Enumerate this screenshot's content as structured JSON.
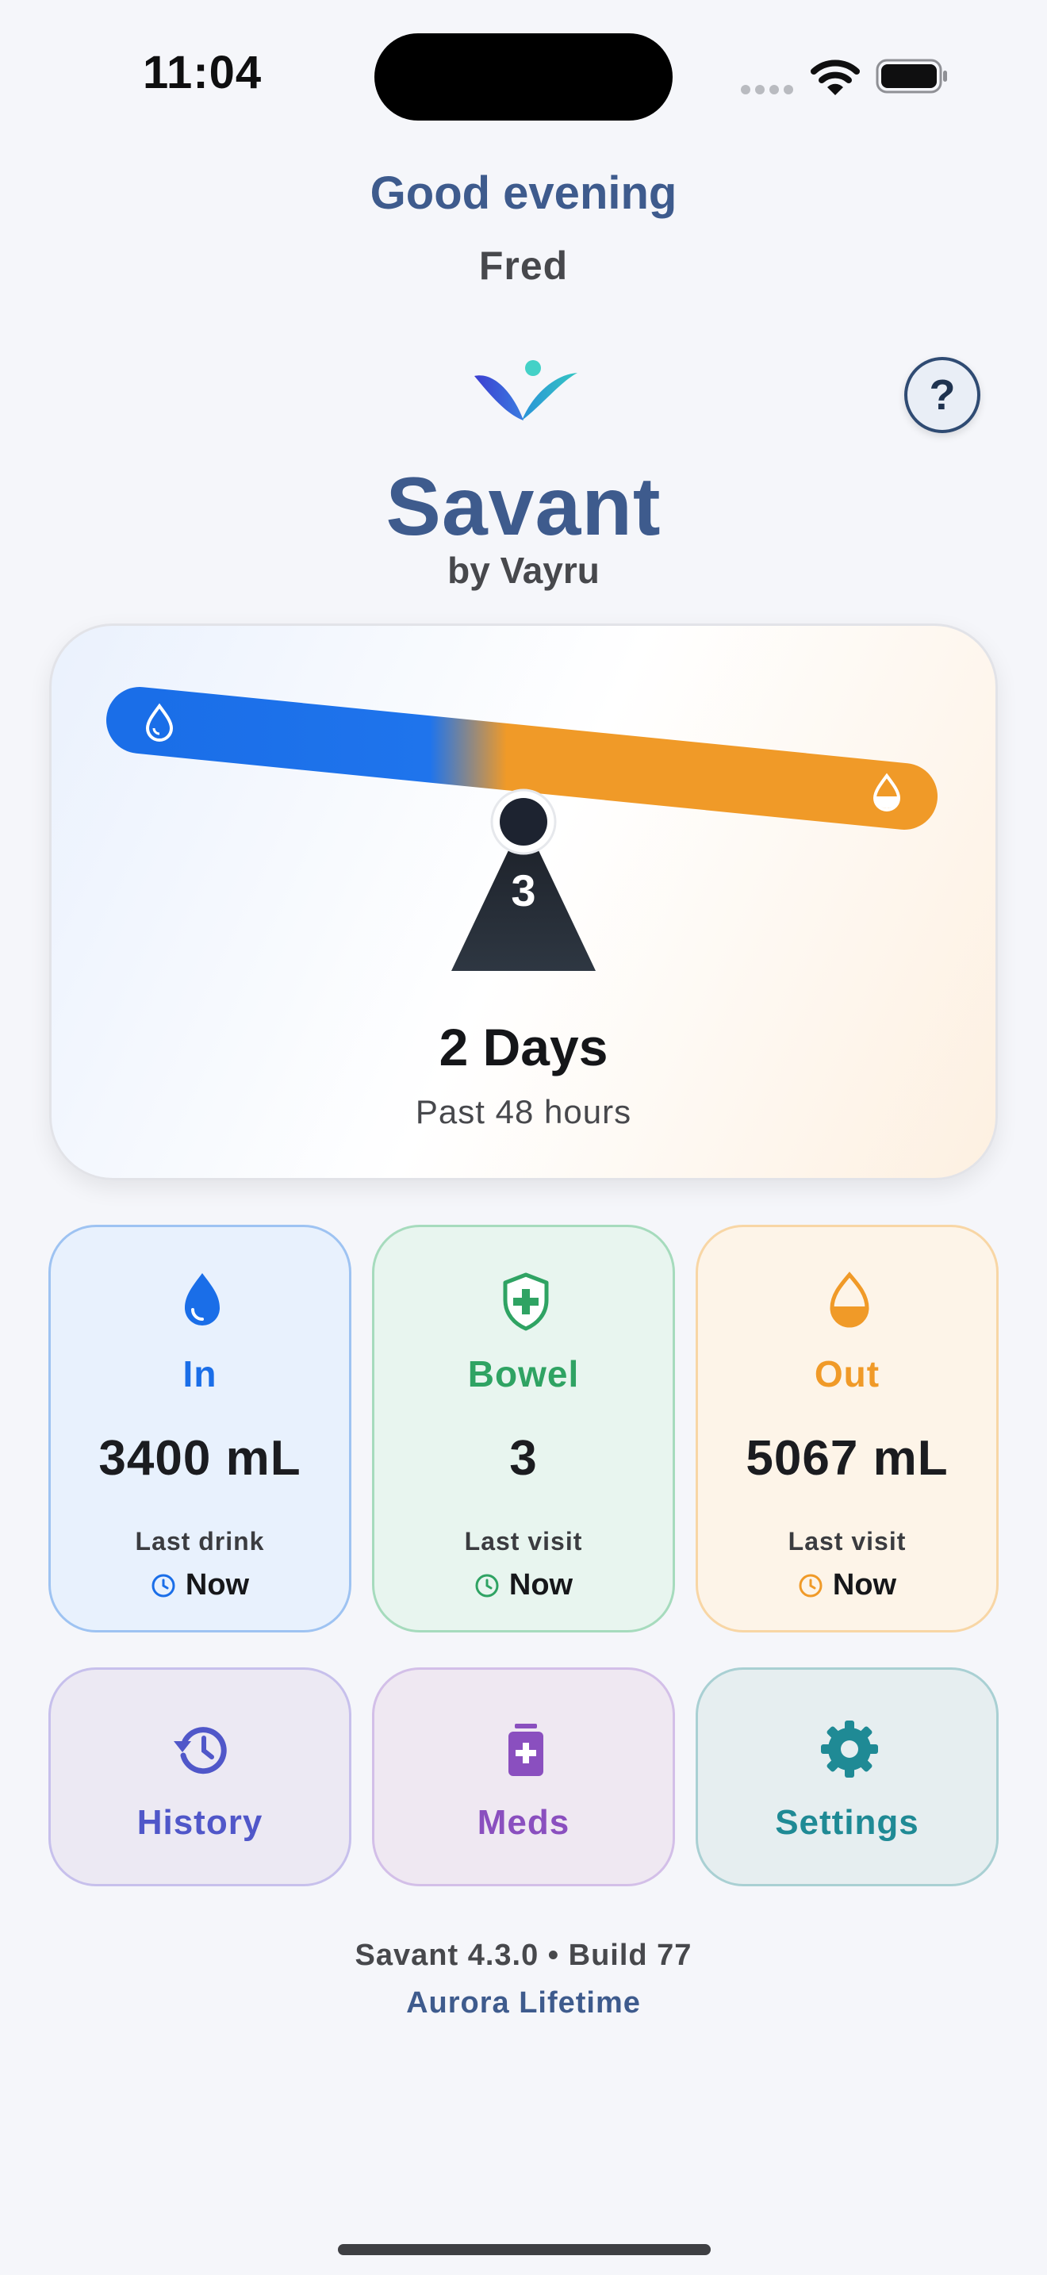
{
  "status_bar": {
    "time": "11:04"
  },
  "header": {
    "greeting": "Good evening",
    "user_name": "Fred"
  },
  "brand": {
    "app_name": "Savant",
    "byline": "by Vayru",
    "help_label": "?"
  },
  "balance": {
    "score": "3",
    "period_value": "2 Days",
    "period_label": "Past 48 hours",
    "intake_color": "#1a6ee8",
    "output_color": "#f09a28"
  },
  "stats": [
    {
      "label": "In",
      "value": "3400 mL",
      "sub": "Last drink",
      "when": "Now",
      "color": "#1a6ee8",
      "icon": "water-drop-icon"
    },
    {
      "label": "Bowel",
      "value": "3",
      "sub": "Last visit",
      "when": "Now",
      "color": "#2fa363",
      "icon": "shield-plus-icon"
    },
    {
      "label": "Out",
      "value": "5067 mL",
      "sub": "Last visit",
      "when": "Now",
      "color": "#f09a28",
      "icon": "half-drop-icon"
    }
  ],
  "actions": [
    {
      "label": "History",
      "color": "#5057c9",
      "icon": "history-icon"
    },
    {
      "label": "Meds",
      "color": "#8a4fbf",
      "icon": "pill-bottle-icon"
    },
    {
      "label": "Settings",
      "color": "#1f8a95",
      "icon": "gear-icon"
    }
  ],
  "footer": {
    "version": "Savant 4.3.0 • Build 77",
    "plan": "Aurora Lifetime"
  }
}
